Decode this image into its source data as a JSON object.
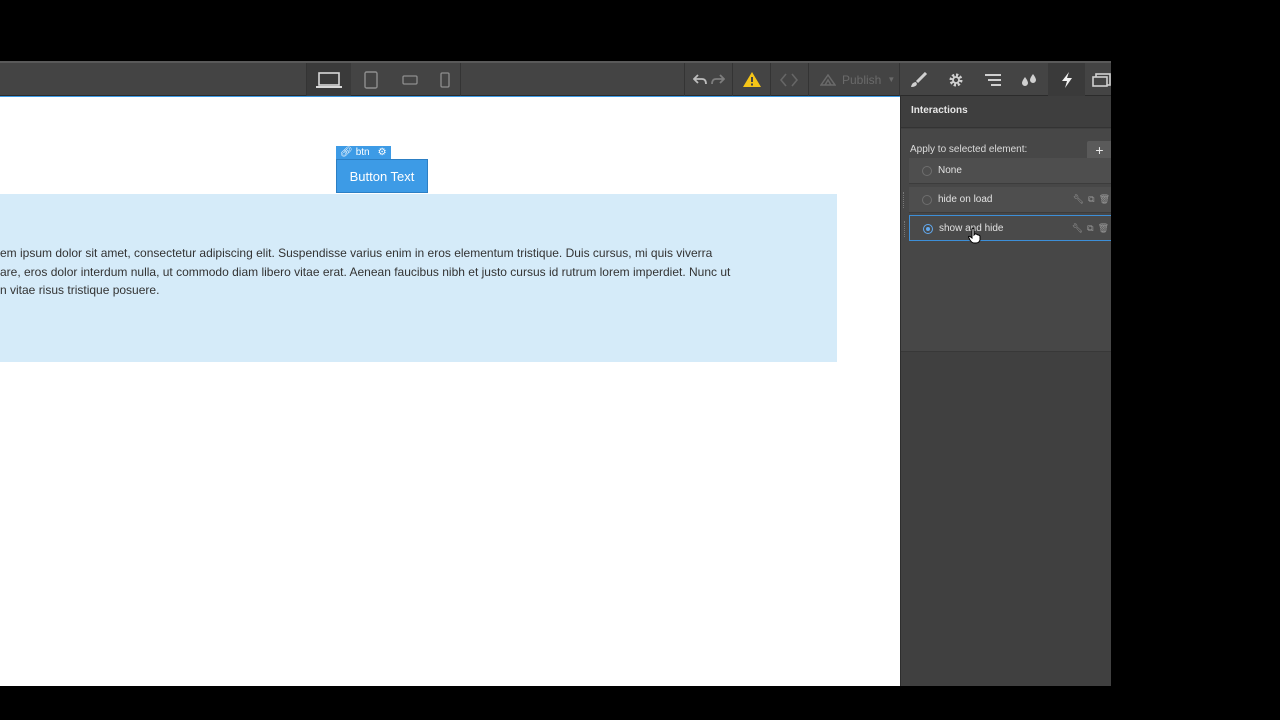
{
  "toolbar": {
    "devices": [
      "desktop-icon",
      "tablet-icon",
      "mobile-landscape-icon",
      "mobile-portrait-icon"
    ],
    "publish_label": "Publish",
    "panel_tabs": [
      "brush-icon",
      "gear-icon",
      "navigator-icon",
      "drops-icon",
      "lightning-icon",
      "assets-icon"
    ]
  },
  "canvas": {
    "element_label": "btn",
    "button_text": "Button Text",
    "paragraph": "em ipsum dolor sit amet, consectetur adipiscing elit. Suspendisse varius enim in eros elementum tristique. Duis cursus, mi quis viverra\nare, eros dolor interdum nulla, ut commodo diam libero vitae erat. Aenean faucibus nibh et justo cursus id rutrum lorem imperdiet. Nunc ut\nn vitae risus tristique posuere."
  },
  "panel": {
    "title": "Interactions",
    "apply_label": "Apply to selected element:",
    "add_label": "+",
    "interactions": [
      {
        "label": "None",
        "selected": false
      },
      {
        "label": "hide on load",
        "selected": false
      },
      {
        "label": "show and hide",
        "selected": true
      }
    ]
  },
  "colors": {
    "accent": "#3d9be6",
    "section_bg": "#d5ebf9",
    "warning": "#f5c518"
  }
}
